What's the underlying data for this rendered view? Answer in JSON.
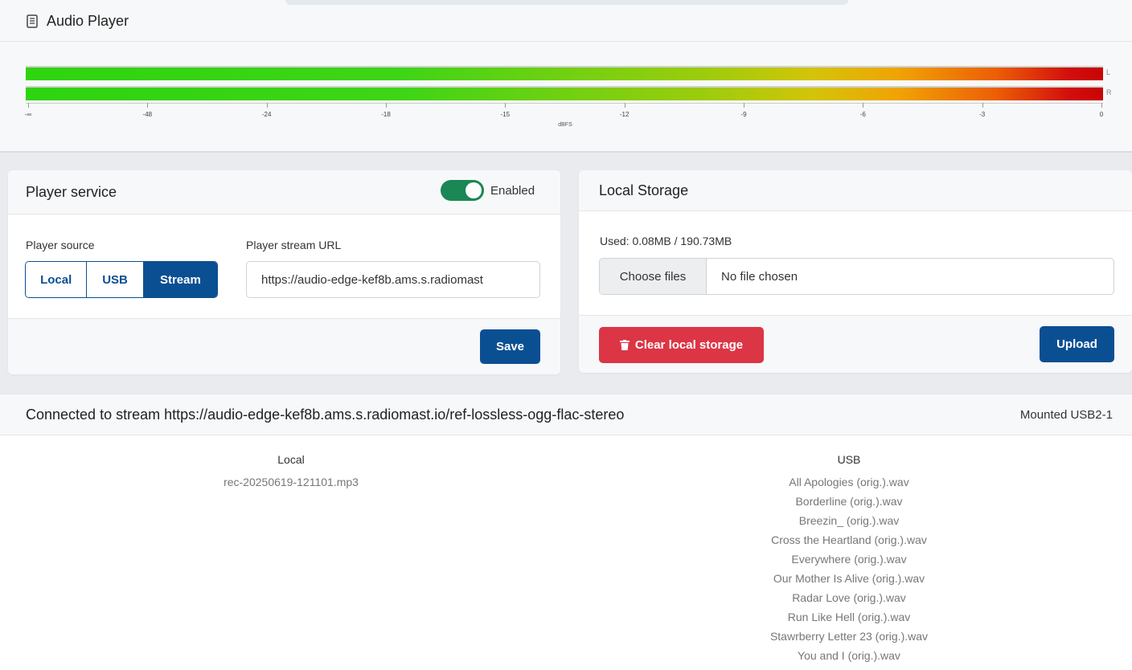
{
  "app": {
    "title": "Audio Player",
    "icon": "file-icon"
  },
  "meter": {
    "channels": [
      "L",
      "R"
    ],
    "ticks": [
      "-∞",
      "-48",
      "-24",
      "-18",
      "-15",
      "-12",
      "-9",
      "-6",
      "-3",
      "0"
    ],
    "axis_label": "dBFS",
    "levels": {
      "L": 1.0,
      "R": 1.0
    },
    "gradient_colors": [
      "#2ed40f",
      "#d3c40a",
      "#c80505"
    ]
  },
  "player_service": {
    "title": "Player service",
    "toggle_label": "Enabled",
    "toggle_on": true,
    "source_label": "Player source",
    "sources": [
      "Local",
      "USB",
      "Stream"
    ],
    "selected_source": "Stream",
    "url_label": "Player stream URL",
    "url_value": "https://audio-edge-kef8b.ams.s.radiomast",
    "save_label": "Save"
  },
  "local_storage": {
    "title": "Local Storage",
    "used": "Used: 0.08MB / 190.73MB",
    "choose_label": "Choose files",
    "no_file": "No file chosen",
    "clear_label": "Clear local storage",
    "upload_label": "Upload"
  },
  "status": {
    "connected": "Connected to stream https://audio-edge-kef8b.ams.s.radiomast.io/ref-lossless-ogg-flac-stereo",
    "mounted": "Mounted USB2-1"
  },
  "lists": {
    "local": {
      "title": "Local",
      "items": [
        "rec-20250619-121101.mp3"
      ]
    },
    "usb": {
      "title": "USB",
      "items": [
        "All Apologies (orig.).wav",
        "Borderline (orig.).wav",
        "Breezin_ (orig.).wav",
        "Cross the Heartland (orig.).wav",
        "Everywhere (orig.).wav",
        "Our Mother Is Alive (orig.).wav",
        "Radar Love (orig.).wav",
        "Run Like Hell (orig.).wav",
        "Stawrberry Letter 23 (orig.).wav",
        "You and I (orig.).wav"
      ]
    }
  },
  "colors": {
    "primary": "#0b4f93",
    "danger": "#dc3545",
    "toggle": "#1a8754"
  }
}
